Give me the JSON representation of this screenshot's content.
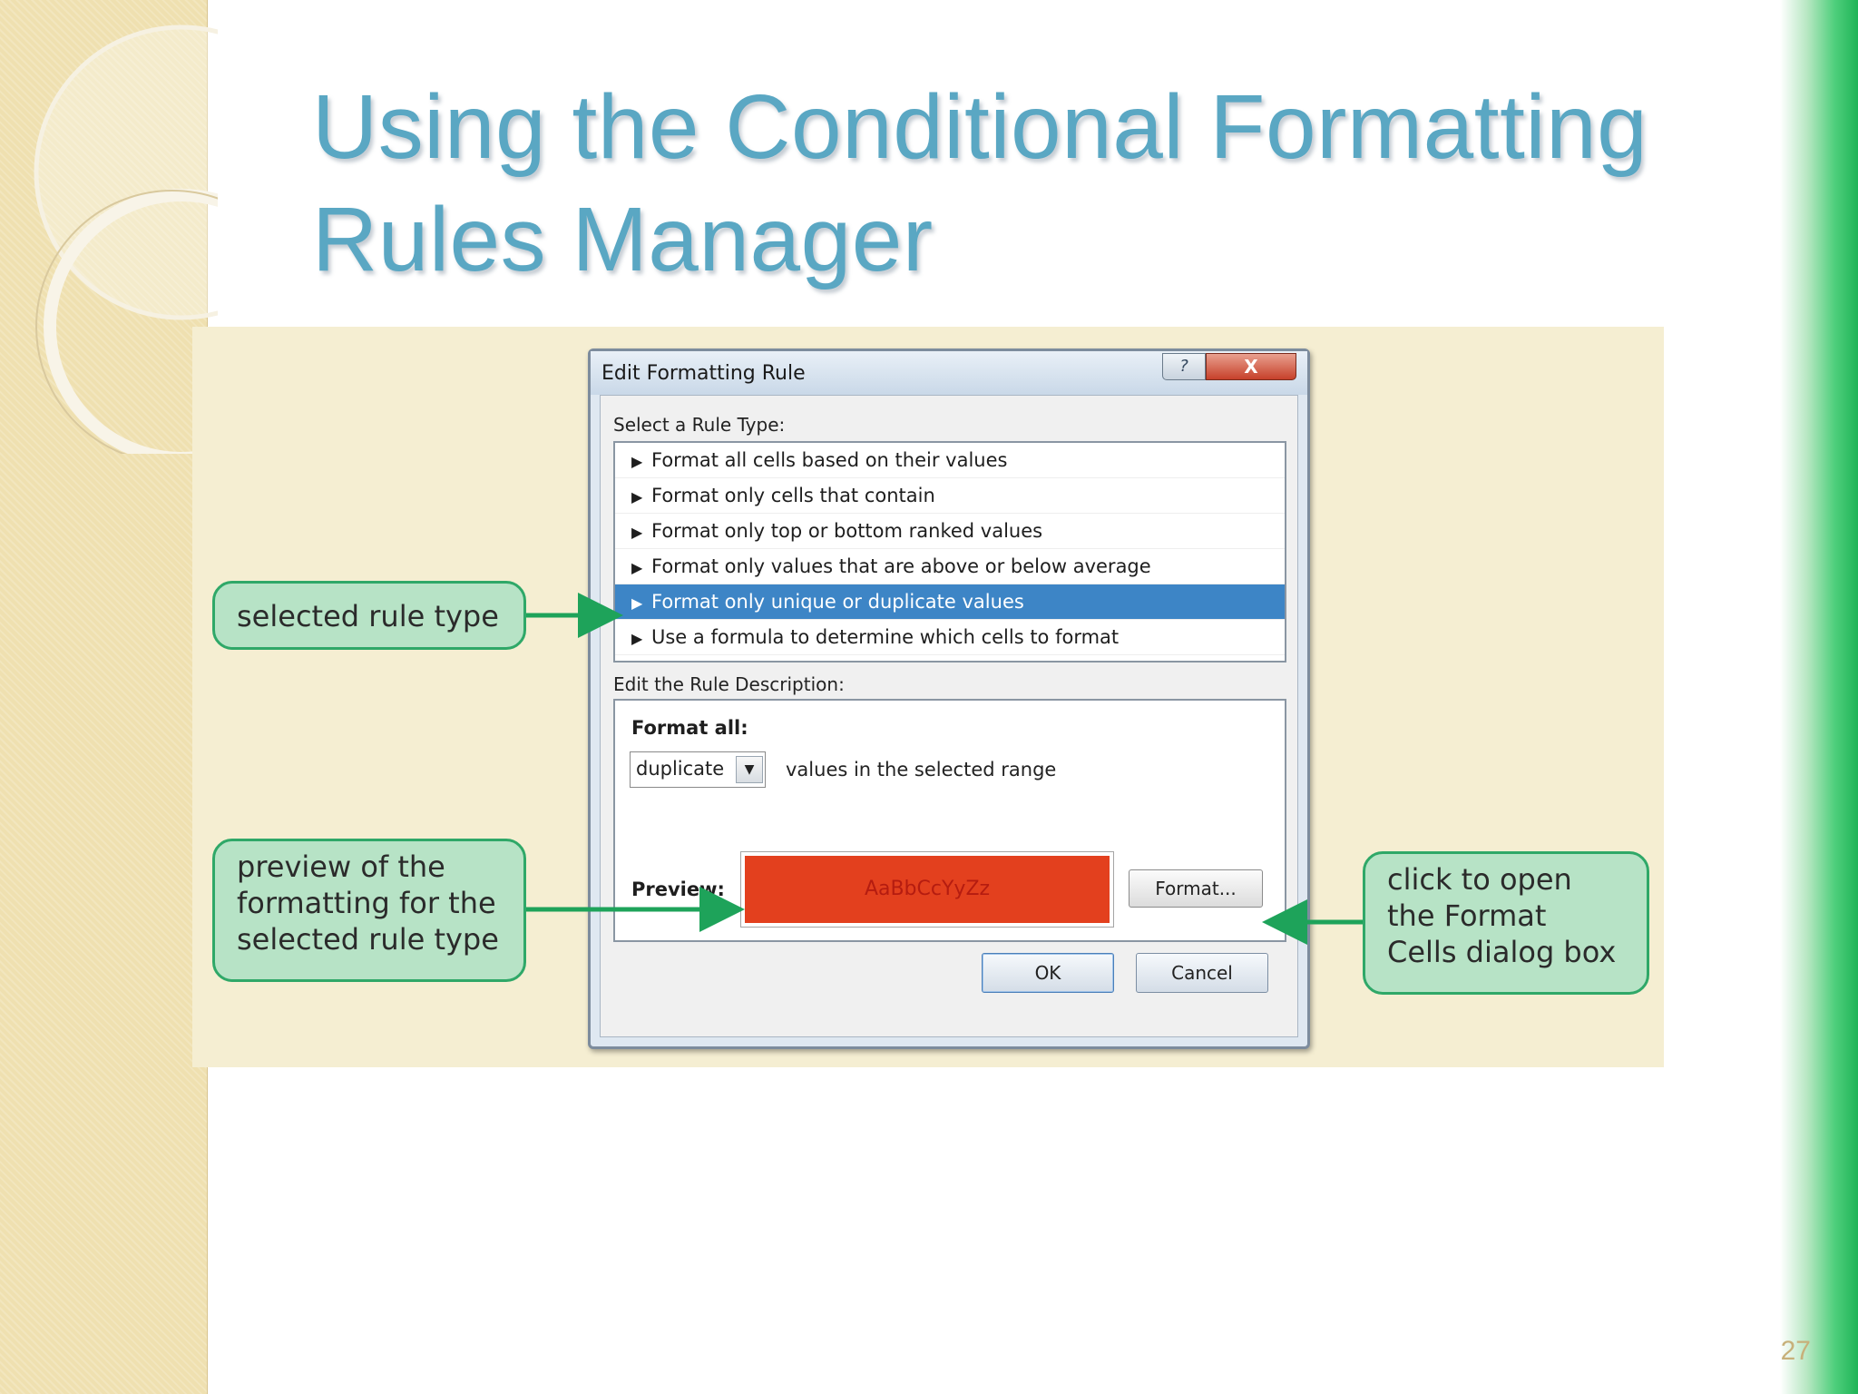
{
  "slide": {
    "title_line1": "Using the Conditional Formatting",
    "title_line2": "Rules Manager",
    "page_number": "27"
  },
  "dialog": {
    "title": "Edit Formatting Rule",
    "help_label": "?",
    "close_label": "X",
    "rule_type_label": "Select a Rule Type:",
    "rule_types": [
      "Format all cells based on their values",
      "Format only cells that contain",
      "Format only top or bottom ranked values",
      "Format only values that are above or below average",
      "Format only unique or duplicate values",
      "Use a formula to determine which cells to format"
    ],
    "selected_rule_index": 4,
    "description_label": "Edit the Rule Description:",
    "format_all_label": "Format all:",
    "dropdown_value": "duplicate",
    "dropdown_arrow": "▼",
    "range_text": "values in the selected range",
    "preview_label": "Preview:",
    "preview_sample": "AaBbCcYyZz",
    "format_button": "Format...",
    "ok_button": "OK",
    "cancel_button": "Cancel"
  },
  "callouts": {
    "selected_rule": "selected rule type",
    "preview": "preview of the\nformatting for the\nselected rule type",
    "format": "click to open\nthe Format\nCells dialog box"
  },
  "colors": {
    "title": "#5aa7c3",
    "callout_fill": "#b7e3c6",
    "callout_border": "#2fa868",
    "selection": "#3d85c6",
    "preview_fill": "#e3401e"
  }
}
